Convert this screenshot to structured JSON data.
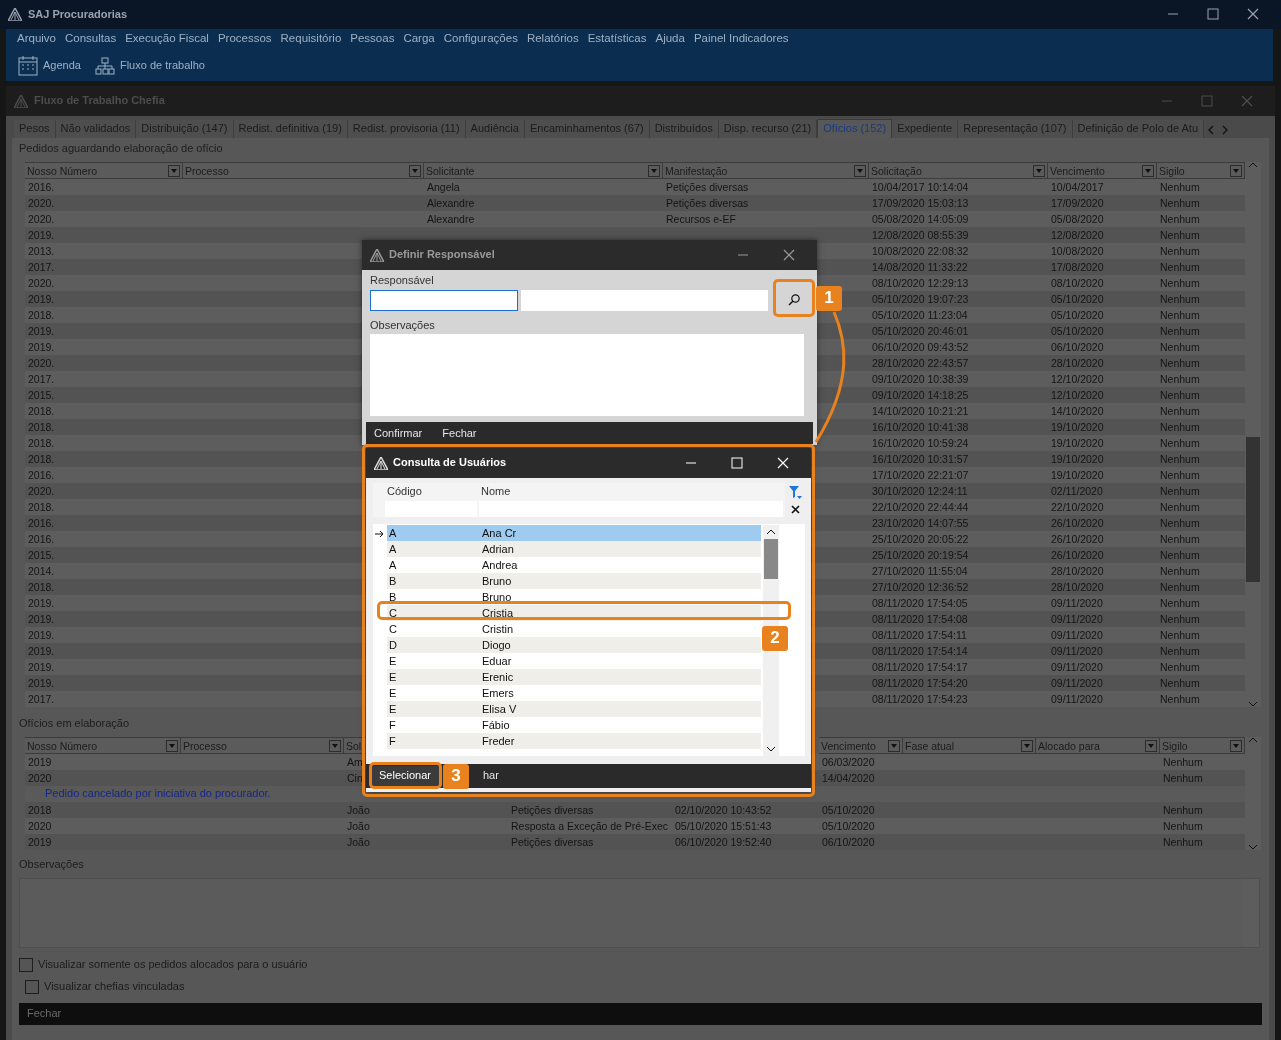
{
  "app": {
    "title": "SAJ Procuradorias",
    "menu": [
      "Arquivo",
      "Consultas",
      "Execução Fiscal",
      "Processos",
      "Requisitório",
      "Pessoas",
      "Carga",
      "Configurações",
      "Relatórios",
      "Estatísticas",
      "Ajuda",
      "Painel Indicadores"
    ],
    "toolbar": [
      {
        "label": "Agenda"
      },
      {
        "label": "Fluxo de trabalho"
      }
    ]
  },
  "window": {
    "title": "Fluxo de Trabalho Chefia"
  },
  "tabs": [
    {
      "label": "Pesos",
      "selected": false
    },
    {
      "label": "Não validados",
      "selected": false
    },
    {
      "label": "Distribuição (147)",
      "selected": false
    },
    {
      "label": "Redist. definitiva (19)",
      "selected": false
    },
    {
      "label": "Redist. provisoria (11)",
      "selected": false
    },
    {
      "label": "Audiência",
      "selected": false
    },
    {
      "label": "Encaminhamentos (67)",
      "selected": false
    },
    {
      "label": "Distribuídos",
      "selected": false
    },
    {
      "label": "Disp. recurso (21)",
      "selected": false
    },
    {
      "label": "Ofícios (152)",
      "selected": true
    },
    {
      "label": "Expediente",
      "selected": false
    },
    {
      "label": "Representação (107)",
      "selected": false
    },
    {
      "label": "Definição de Polo de Atu",
      "selected": false
    }
  ],
  "pending": {
    "title": "Pedidos aguardando elaboração de ofício",
    "columns": [
      "Nosso Número",
      "Processo",
      "Solicitante",
      "Manifestação",
      "Solicitação",
      "Vencimento",
      "Sigilo"
    ],
    "rows": [
      {
        "numero": "2016.",
        "solicitante": "Angela",
        "manifestacao": "Petições diversas",
        "solicitacao": "10/04/2017 10:14:04",
        "vencimento": "10/04/2017",
        "sigilo": "Nenhum"
      },
      {
        "numero": "2020.",
        "solicitante": "Alexandre",
        "manifestacao": "Petições diversas",
        "solicitacao": "17/09/2020 15:03:13",
        "vencimento": "17/09/2020",
        "sigilo": "Nenhum"
      },
      {
        "numero": "2020.",
        "solicitante": "Alexandre",
        "manifestacao": "Recursos e-EF",
        "solicitacao": "05/08/2020 14:05:09",
        "vencimento": "05/08/2020",
        "sigilo": "Nenhum"
      },
      {
        "numero": "2019.",
        "solicitacao": "12/08/2020 08:55:39",
        "vencimento": "12/08/2020",
        "sigilo": "Nenhum"
      },
      {
        "numero": "2013.",
        "solicitacao": "10/08/2020 22:08:32",
        "vencimento": "10/08/2020",
        "sigilo": "Nenhum"
      },
      {
        "numero": "2017.",
        "solicitacao": "14/08/2020 11:33:22",
        "vencimento": "17/08/2020",
        "sigilo": "Nenhum"
      },
      {
        "numero": "2020.",
        "solicitacao": "08/10/2020 12:29:13",
        "vencimento": "08/10/2020",
        "sigilo": "Nenhum"
      },
      {
        "numero": "2019.",
        "solicitacao": "05/10/2020 19:07:23",
        "vencimento": "05/10/2020",
        "sigilo": "Nenhum"
      },
      {
        "numero": "2018.",
        "solicitacao": "05/10/2020 11:23:04",
        "vencimento": "05/10/2020",
        "sigilo": "Nenhum"
      },
      {
        "numero": "2019.",
        "solicitacao": "05/10/2020 20:46:01",
        "vencimento": "05/10/2020",
        "sigilo": "Nenhum"
      },
      {
        "numero": "2019.",
        "solicitacao": "06/10/2020 09:43:52",
        "vencimento": "06/10/2020",
        "sigilo": "Nenhum"
      },
      {
        "numero": "2020.",
        "solicitacao": "28/10/2020 22:43:57",
        "vencimento": "28/10/2020",
        "sigilo": "Nenhum"
      },
      {
        "numero": "2017.",
        "solicitacao": "09/10/2020 10:38:39",
        "vencimento": "12/10/2020",
        "sigilo": "Nenhum"
      },
      {
        "numero": "2015.",
        "solicitacao": "09/10/2020 14:18:25",
        "vencimento": "12/10/2020",
        "sigilo": "Nenhum"
      },
      {
        "numero": "2018.",
        "solicitacao": "14/10/2020 10:21:21",
        "vencimento": "14/10/2020",
        "sigilo": "Nenhum"
      },
      {
        "numero": "2018.",
        "solicitacao": "16/10/2020 10:41:38",
        "vencimento": "19/10/2020",
        "sigilo": "Nenhum"
      },
      {
        "numero": "2018.",
        "solicitacao": "16/10/2020 10:59:24",
        "vencimento": "19/10/2020",
        "sigilo": "Nenhum"
      },
      {
        "numero": "2018.",
        "solicitacao": "16/10/2020 10:31:57",
        "vencimento": "19/10/2020",
        "sigilo": "Nenhum"
      },
      {
        "numero": "2016.",
        "solicitacao": "17/10/2020 22:21:07",
        "vencimento": "19/10/2020",
        "sigilo": "Nenhum"
      },
      {
        "numero": "2020.",
        "solicitacao": "30/10/2020 12:24:11",
        "vencimento": "02/11/2020",
        "sigilo": "Nenhum"
      },
      {
        "numero": "2018.",
        "solicitacao": "22/10/2020 22:44:44",
        "vencimento": "22/10/2020",
        "sigilo": "Nenhum"
      },
      {
        "numero": "2016.",
        "solicitacao": "23/10/2020 14:07:55",
        "vencimento": "26/10/2020",
        "sigilo": "Nenhum"
      },
      {
        "numero": "2016.",
        "solicitacao": "25/10/2020 20:05:22",
        "vencimento": "26/10/2020",
        "sigilo": "Nenhum"
      },
      {
        "numero": "2015.",
        "solicitacao": "25/10/2020 20:19:54",
        "vencimento": "26/10/2020",
        "sigilo": "Nenhum"
      },
      {
        "numero": "2014.",
        "solicitacao": "27/10/2020 11:55:04",
        "vencimento": "28/10/2020",
        "sigilo": "Nenhum"
      },
      {
        "numero": "2018.",
        "solicitacao": "27/10/2020 12:36:52",
        "vencimento": "28/10/2020",
        "sigilo": "Nenhum"
      },
      {
        "numero": "2019.",
        "solicitacao": "08/11/2020 17:54:05",
        "vencimento": "09/11/2020",
        "sigilo": "Nenhum"
      },
      {
        "numero": "2019.",
        "solicitacao": "08/11/2020 17:54:08",
        "vencimento": "09/11/2020",
        "sigilo": "Nenhum"
      },
      {
        "numero": "2019.",
        "solicitacao": "08/11/2020 17:54:11",
        "vencimento": "09/11/2020",
        "sigilo": "Nenhum"
      },
      {
        "numero": "2019.",
        "solicitacao": "08/11/2020 17:54:14",
        "vencimento": "09/11/2020",
        "sigilo": "Nenhum"
      },
      {
        "numero": "2019.",
        "solicitacao": "08/11/2020 17:54:17",
        "vencimento": "09/11/2020",
        "sigilo": "Nenhum"
      },
      {
        "numero": "2019.",
        "solicitacao": "08/11/2020 17:54:20",
        "vencimento": "09/11/2020",
        "sigilo": "Nenhum"
      },
      {
        "numero": "2017.",
        "solicitacao": "08/11/2020 17:54:23",
        "vencimento": "09/11/2020",
        "sigilo": "Nenhum"
      }
    ]
  },
  "in_progress": {
    "title": "Ofícios em elaboração",
    "columns": [
      "Nosso Número",
      "Processo",
      "Sol",
      "Vencimento",
      "Fase atual",
      "Alocado para",
      "Sigilo"
    ],
    "rows": [
      {
        "kind": "row",
        "numero": "2019",
        "solicitante": "Am",
        "vencimento": "06/03/2020",
        "sigilo": "Nenhum"
      },
      {
        "kind": "row",
        "numero": "2020",
        "solicitante": "Cin",
        "vencimento": "14/04/2020",
        "sigilo": "Nenhum"
      },
      {
        "kind": "message",
        "text": "Pedido cancelado por iniciativa do procurador."
      },
      {
        "kind": "row",
        "numero": "2018",
        "solicitante": "João",
        "manifestacao": "Petições diversas",
        "solicitacao": "02/10/2020 10:43:52",
        "vencimento": "05/10/2020",
        "sigilo": "Nenhum"
      },
      {
        "kind": "row",
        "numero": "2020",
        "solicitante": "João",
        "manifestacao": "Resposta a Exceção de Pré-Exec",
        "solicitacao": "05/10/2020 15:51:43",
        "vencimento": "05/10/2020",
        "sigilo": "Nenhum"
      },
      {
        "kind": "row",
        "numero": "2019",
        "solicitante": "João",
        "manifestacao": "Petições diversas",
        "solicitacao": "06/10/2020 19:52:40",
        "vencimento": "06/10/2020",
        "sigilo": "Nenhum"
      }
    ]
  },
  "observations": {
    "label": "Observações"
  },
  "options": [
    {
      "label": "Visualizar somente os pedidos alocados para o usuário",
      "checked": false
    },
    {
      "label": "Visualizar chefias vinculadas",
      "checked": false
    }
  ],
  "footer": {
    "buttons": [
      "Fechar"
    ]
  },
  "dialog_responsavel": {
    "title": "Definir Responsável",
    "field_label": "Responsável",
    "observations_label": "Observações",
    "buttons": [
      "Confirmar",
      "Fechar"
    ]
  },
  "dialog_users": {
    "title": "Consulta de Usuários",
    "columns": [
      "Código",
      "Nome"
    ],
    "rows": [
      {
        "code": "A",
        "name": "Ana Cr",
        "selected": true
      },
      {
        "code": "A",
        "name": "Adrian",
        "selected": false
      },
      {
        "code": "A",
        "name": "Andrea",
        "selected": false
      },
      {
        "code": "B",
        "name": "Bruno",
        "selected": false
      },
      {
        "code": "B",
        "name": "Bruno",
        "selected": false
      },
      {
        "code": "C",
        "name": "Cristia",
        "selected": false
      },
      {
        "code": "C",
        "name": "Cristin",
        "selected": false
      },
      {
        "code": "D",
        "name": "Diogo",
        "selected": false
      },
      {
        "code": "E",
        "name": "Eduar",
        "selected": false
      },
      {
        "code": "E",
        "name": "Erenic",
        "selected": false
      },
      {
        "code": "E",
        "name": "Emers",
        "selected": false
      },
      {
        "code": "E",
        "name": "Elisa V",
        "selected": false
      },
      {
        "code": "F",
        "name": "Fábio",
        "selected": false
      },
      {
        "code": "F",
        "name": "Freder",
        "selected": false
      }
    ],
    "buttons": [
      "Selecionar",
      "har"
    ]
  },
  "callouts": [
    {
      "number": "1"
    },
    {
      "number": "2"
    },
    {
      "number": "3"
    }
  ]
}
